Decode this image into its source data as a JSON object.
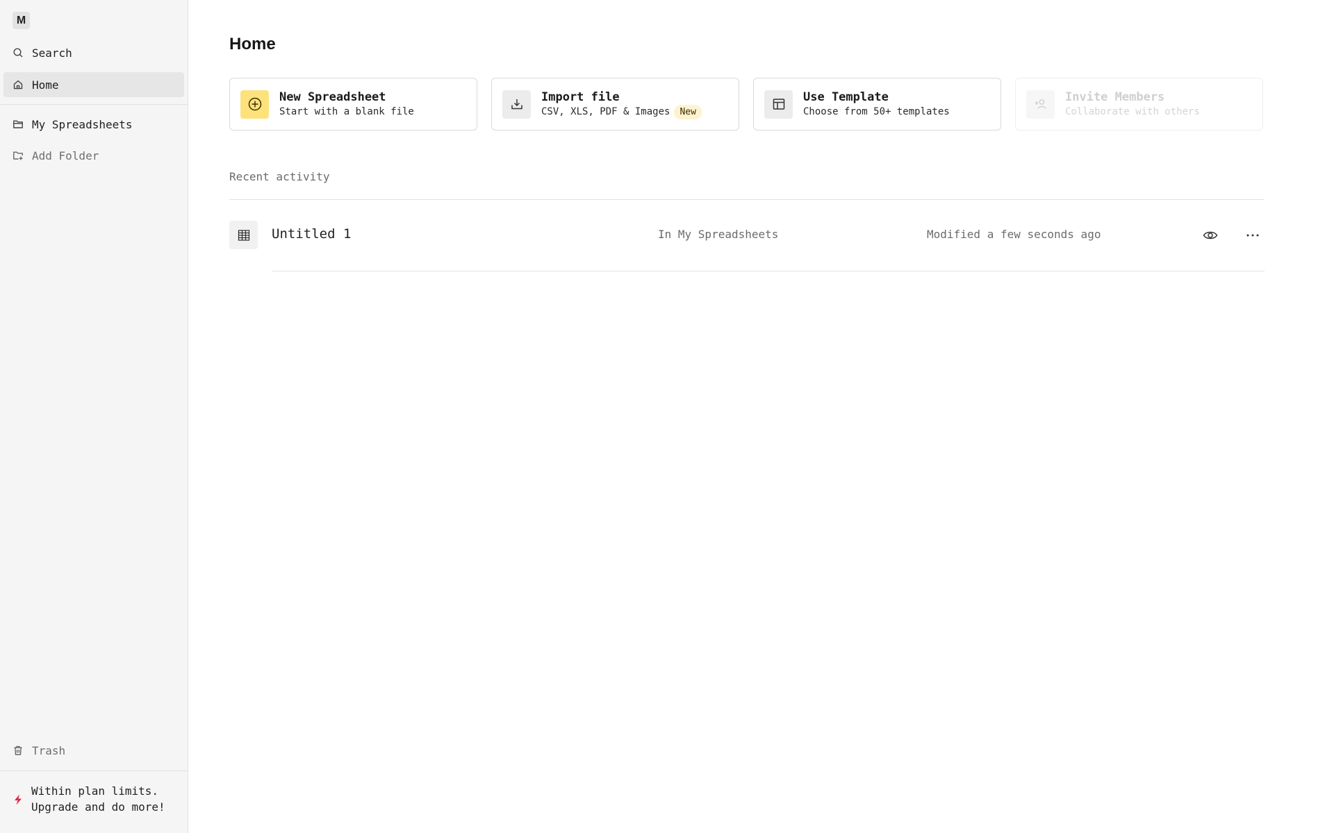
{
  "workspace": {
    "initial": "M"
  },
  "sidebar": {
    "search_label": "Search",
    "home_label": "Home",
    "my_spreadsheets_label": "My Spreadsheets",
    "add_folder_label": "Add Folder",
    "trash_label": "Trash",
    "upgrade": {
      "line1": "Within plan limits.",
      "line2": "Upgrade and do more!",
      "icon": "lightning-icon",
      "icon_color": "#e0264b"
    }
  },
  "main": {
    "title": "Home",
    "cards": [
      {
        "title": "New Spreadsheet",
        "subtitle": "Start with a blank file",
        "icon": "plus-circle-icon",
        "icon_bg": "#fde27c"
      },
      {
        "title": "Import file",
        "subtitle": "CSV, XLS, PDF & Images",
        "badge": "New",
        "icon": "download-tray-icon"
      },
      {
        "title": "Use Template",
        "subtitle": "Choose from 50+ templates",
        "icon": "layout-template-icon"
      },
      {
        "title": "Invite Members",
        "subtitle": "Collaborate with others",
        "icon": "add-user-icon",
        "disabled": true
      }
    ],
    "recent": {
      "label": "Recent activity",
      "items": [
        {
          "name": "Untitled 1",
          "location": "In My Spreadsheets",
          "modified": "Modified a few seconds ago",
          "icon": "table-grid-icon"
        }
      ]
    }
  }
}
